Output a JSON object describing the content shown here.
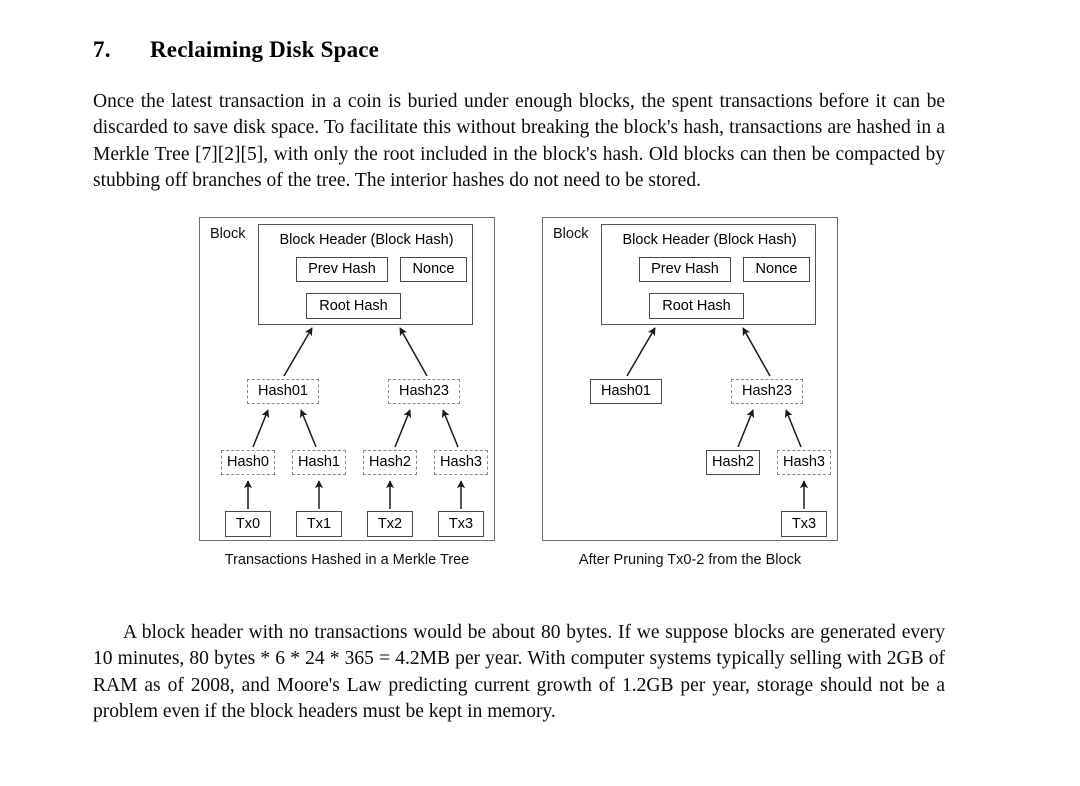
{
  "heading": {
    "number": "7.",
    "title": "Reclaiming Disk Space"
  },
  "paragraphs": {
    "intro": "Once the latest transaction in a coin is buried under enough blocks, the spent transactions before it can be discarded to save disk space.  To facilitate this without breaking the block's hash, transactions are hashed in a Merkle Tree [7][2][5], with only the root included in the block's hash. Old blocks can then be compacted by stubbing off branches of the tree.  The interior hashes do not need to be stored.",
    "outro": "A block header with no transactions would be about 80 bytes.  If we suppose blocks are generated every 10 minutes, 80 bytes * 6 * 24 * 365 = 4.2MB per year.  With computer systems typically selling with 2GB of RAM as of 2008, and Moore's Law predicting current growth of 1.2GB per year, storage should not be a problem even if the block headers must be kept in memory."
  },
  "figures": {
    "left": {
      "block_label": "Block",
      "caption": "Transactions Hashed in a Merkle Tree",
      "header": {
        "title": "Block Header (Block Hash)",
        "prev_hash": "Prev Hash",
        "nonce": "Nonce",
        "root_hash": "Root Hash"
      },
      "level2": [
        {
          "label": "Hash01",
          "style": "dashed"
        },
        {
          "label": "Hash23",
          "style": "dashed"
        }
      ],
      "level1": [
        {
          "label": "Hash0",
          "style": "dashed"
        },
        {
          "label": "Hash1",
          "style": "dashed"
        },
        {
          "label": "Hash2",
          "style": "dashed"
        },
        {
          "label": "Hash3",
          "style": "dashed"
        }
      ],
      "transactions": [
        {
          "label": "Tx0",
          "style": "solid"
        },
        {
          "label": "Tx1",
          "style": "solid"
        },
        {
          "label": "Tx2",
          "style": "solid"
        },
        {
          "label": "Tx3",
          "style": "solid"
        }
      ]
    },
    "right": {
      "block_label": "Block",
      "caption": "After Pruning Tx0-2 from the Block",
      "header": {
        "title": "Block Header (Block Hash)",
        "prev_hash": "Prev Hash",
        "nonce": "Nonce",
        "root_hash": "Root Hash"
      },
      "level2": [
        {
          "label": "Hash01",
          "style": "solid"
        },
        {
          "label": "Hash23",
          "style": "dashed"
        }
      ],
      "level1": [
        {
          "label": "Hash2",
          "style": "solid"
        },
        {
          "label": "Hash3",
          "style": "dashed"
        }
      ],
      "transactions": [
        {
          "label": "Tx3",
          "style": "solid"
        }
      ]
    }
  },
  "colors": {
    "page_background": "#ffffff",
    "text": "#000000",
    "box_solid_border": "#4a4a4a",
    "box_dashed_border": "#8a8a8a",
    "outer_border": "#6e6e6e",
    "arrow": "#1a1a1a"
  }
}
